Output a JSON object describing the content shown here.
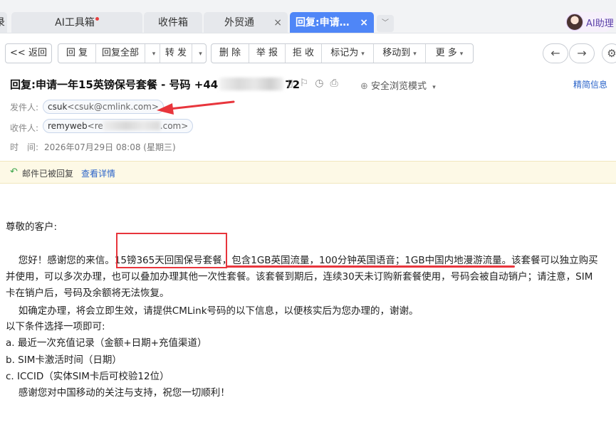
{
  "tabs": [
    {
      "label": "录",
      "active": false,
      "closable": false
    },
    {
      "label": "AI工具箱",
      "active": false,
      "closable": false,
      "badge_dot": true
    },
    {
      "label": "收件箱",
      "active": false,
      "closable": false
    },
    {
      "label": "外贸通",
      "active": false,
      "closable": true
    },
    {
      "label": "回复:申请一...",
      "active": true,
      "closable": true
    }
  ],
  "tab_close_glyph": "×",
  "tab_more_glyph": "﹀",
  "ai_assistant": {
    "label": "AI助理"
  },
  "toolbar": {
    "back": "<< 返回",
    "reply": "回 复",
    "reply_all": "回复全部",
    "forward": "转 发",
    "delete": "删 除",
    "report": "举 报",
    "reject": "拒 收",
    "mark_as": "标记为",
    "move_to": "移动到",
    "more": "更 多",
    "prev_glyph": "←",
    "next_glyph": "→",
    "gear_glyph": "⚙"
  },
  "email": {
    "subject_prefix": "回复:申请一年15英镑保号套餐 - 号码 +44",
    "subject_suffix": "72",
    "safe_mode": "安全浏览模式",
    "brief_info": "精简信息",
    "sender_label": "发件人:",
    "sender_name": "csuk",
    "sender_address": "<csuk@cmlink.com>",
    "recipient_label": "收件人:",
    "recipient_name": "remyweb",
    "recipient_address_start": "<re",
    "recipient_address_end": ".com>",
    "time_label": "时　间:",
    "time_value": "2026年07月29日 08:08 (星期三)",
    "notice_text": "邮件已被回复",
    "notice_link": "查看详情"
  },
  "body_lines": [
    "尊敬的客户:",
    "　 您好！感谢您的来信。15镑365天回国保号套餐，包含1GB英国流量，100分钟英国语音；1GB中国内地漫游流量。该套餐可以独立购买",
    "并使用，可以多次办理，也可以叠加办理其他一次性套餐。该套餐到期后，连续30天未订购新套餐使用，号码会被自动销户；请注意，SIM",
    "卡在销户后，号码及余额将无法恢复。",
    "　 如确定办理，将会立即生效，请提供CMLink号码的以下信息，以便核实后为您办理的，谢谢。",
    "以下条件选择一项即可:",
    "a. 最近一次充值记录（金额+日期+充值渠道）",
    "b. SIM卡激活时间（日期）",
    "c. ICCID（实体SIM卡后可校验12位）",
    "　 感谢您对中国移动的关注与支持，祝您一切顺利！"
  ],
  "annotation_color": "#e8353c",
  "accent_color": "#4f86f7"
}
